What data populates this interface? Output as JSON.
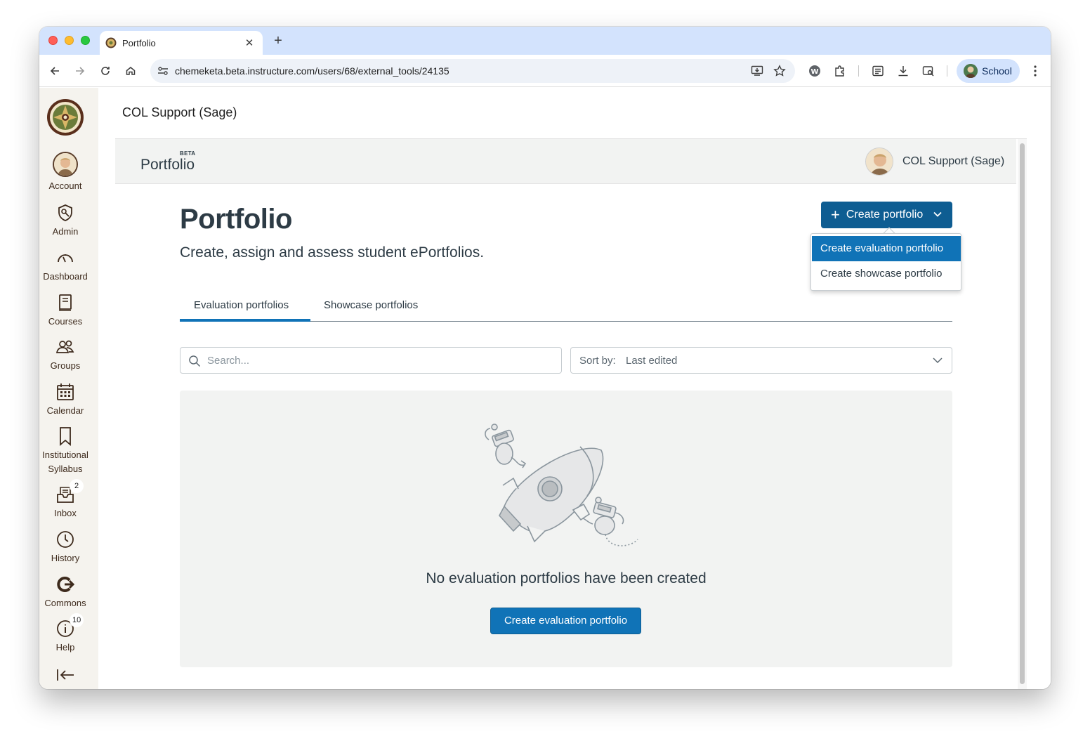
{
  "browser": {
    "tab_title": "Portfolio",
    "url": "chemeketa.beta.instructure.com/users/68/external_tools/24135",
    "profile_label": "School"
  },
  "global_nav": {
    "items": [
      {
        "label": "Account",
        "icon": "avatar"
      },
      {
        "label": "Admin",
        "icon": "shield-icon"
      },
      {
        "label": "Dashboard",
        "icon": "speedometer-icon"
      },
      {
        "label": "Courses",
        "icon": "book-icon"
      },
      {
        "label": "Groups",
        "icon": "people-icon"
      },
      {
        "label": "Calendar",
        "icon": "calendar-icon"
      },
      {
        "label": "Institutional",
        "label2": "Syllabus",
        "icon": "bookmark-icon"
      },
      {
        "label": "Inbox",
        "icon": "inbox-icon",
        "badge": "2"
      },
      {
        "label": "History",
        "icon": "clock-icon"
      },
      {
        "label": "Commons",
        "icon": "commons-icon"
      },
      {
        "label": "Help",
        "icon": "help-icon",
        "badge": "10"
      }
    ]
  },
  "page": {
    "header": "COL Support (Sage)"
  },
  "app": {
    "beta": "BETA",
    "name": "Portfolio",
    "user_name": "COL Support (Sage)"
  },
  "main": {
    "title": "Portfolio",
    "subtitle": "Create, assign and assess student ePortfolios.",
    "create_button": "Create portfolio",
    "menu": {
      "item1": "Create evaluation portfolio",
      "item2": "Create showcase portfolio"
    },
    "tabs": [
      {
        "label": "Evaluation portfolios",
        "selected": true
      },
      {
        "label": "Showcase portfolios",
        "selected": false
      }
    ],
    "search_placeholder": "Search...",
    "sort_label": "Sort by:",
    "sort_value": "Last edited",
    "empty_message": "No evaluation portfolios have been created",
    "empty_button": "Create evaluation portfolio"
  },
  "colors": {
    "brand_blue": "#1073b7",
    "dark_blue": "#0e5d92",
    "nav_bg": "#f5f3ee",
    "nav_text": "#3d2a1c"
  }
}
